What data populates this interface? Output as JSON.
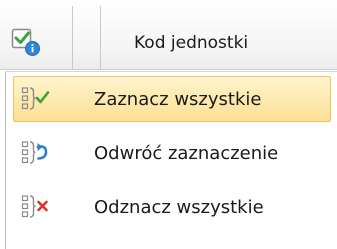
{
  "header": {
    "select_all_icon": "checkbox-check-info-icon",
    "column_label": "Kod jednostki"
  },
  "menu": {
    "items": [
      {
        "label": "Zaznacz wszystkie",
        "icon": "select-all-check-icon",
        "selected": true
      },
      {
        "label": "Odwróć zaznaczenie",
        "icon": "invert-selection-icon",
        "selected": false
      },
      {
        "label": "Odznacz wszystkie",
        "icon": "deselect-all-icon",
        "selected": false
      }
    ]
  },
  "colors": {
    "highlight_top": "#fff4cf",
    "highlight_bottom": "#fbdf94",
    "highlight_border": "#efc35e",
    "check_green": "#3aa33a",
    "arrow_blue": "#2f7fd0",
    "cross_red": "#d9322b"
  }
}
